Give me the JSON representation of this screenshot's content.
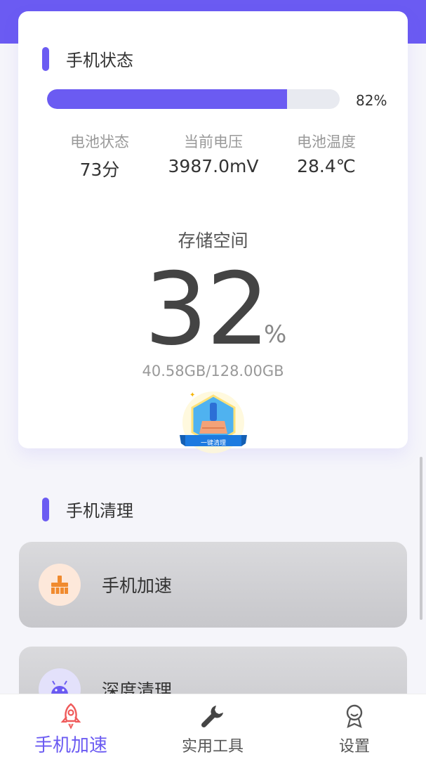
{
  "phone_status": {
    "title": "手机状态",
    "battery_percent_label": "82%",
    "battery_fraction": 0.82,
    "stats": [
      {
        "label": "电池状态",
        "value": "73分"
      },
      {
        "label": "当前电压",
        "value": "3987.0mV"
      },
      {
        "label": "电池温度",
        "value": "28.4℃"
      }
    ],
    "storage": {
      "label": "存储空间",
      "percent": "32",
      "unit": "%",
      "size": "40.58GB/128.00GB"
    },
    "clean_button": {
      "label": "一键清理",
      "icon": "broom-icon"
    }
  },
  "phone_clean": {
    "title": "手机清理",
    "items": [
      {
        "label": "手机加速",
        "icon": "broom-icon"
      },
      {
        "label": "深度清理",
        "icon": "android-icon"
      }
    ]
  },
  "bottom_nav": {
    "items": [
      {
        "label": "手机加速",
        "icon": "rocket-icon",
        "active": true
      },
      {
        "label": "实用工具",
        "icon": "wrench-icon",
        "active": false
      },
      {
        "label": "设置",
        "icon": "settings-badge-icon",
        "active": false
      }
    ]
  },
  "colors": {
    "accent": "#6b5bf2",
    "track": "#e8eaf0",
    "broom_orange": "#f08a2e",
    "android_purple": "#6b5bf2"
  }
}
